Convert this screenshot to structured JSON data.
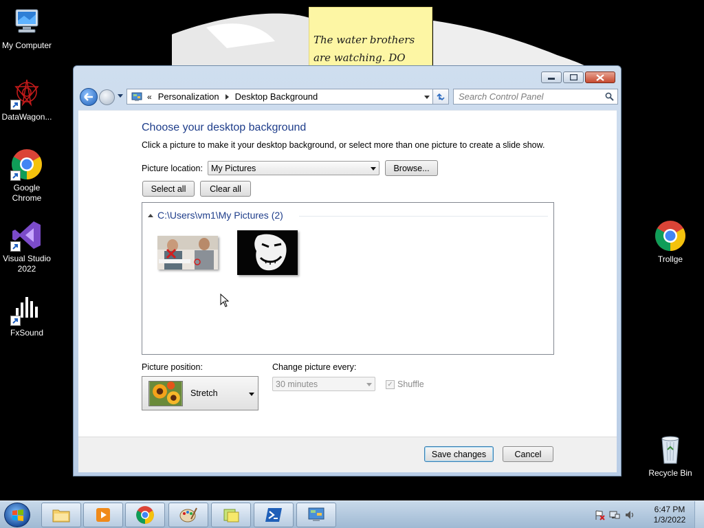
{
  "desktop": {
    "icons": [
      {
        "label": "My Computer"
      },
      {
        "label": "DataWagon..."
      },
      {
        "label": "Google Chrome"
      },
      {
        "label": "Visual Studio 2022"
      },
      {
        "label": "FxSound"
      },
      {
        "label": "Trollge"
      },
      {
        "label": "Recycle Bin"
      }
    ],
    "sticky_note": {
      "line1": "The water brothers",
      "line2": "are watching. DO"
    }
  },
  "window": {
    "address": {
      "chevron": "«",
      "crumbs": [
        "Personalization",
        "Desktop Background"
      ]
    },
    "search": {
      "placeholder": "Search Control Panel"
    },
    "heading": "Choose your desktop background",
    "description": "Click a picture to make it your desktop background, or select more than one picture to create a slide show.",
    "picture_location": {
      "label": "Picture location:",
      "value": "My Pictures",
      "browse": "Browse..."
    },
    "select_all": "Select all",
    "clear_all": "Clear all",
    "group": {
      "title": "C:\\Users\\vm1\\My Pictures (2)"
    },
    "picture_position": {
      "label": "Picture position:",
      "value": "Stretch"
    },
    "change_picture": {
      "label": "Change picture every:",
      "value": "30 minutes"
    },
    "shuffle": {
      "label": "Shuffle",
      "checked": true
    },
    "save": "Save changes",
    "cancel": "Cancel"
  },
  "taskbar": {
    "time": "6:47 PM",
    "date": "1/3/2022"
  },
  "colors": {
    "heading": "#1e3d8a",
    "sticky": "#fdf6a4",
    "taskbar": "#b7cbe0"
  }
}
